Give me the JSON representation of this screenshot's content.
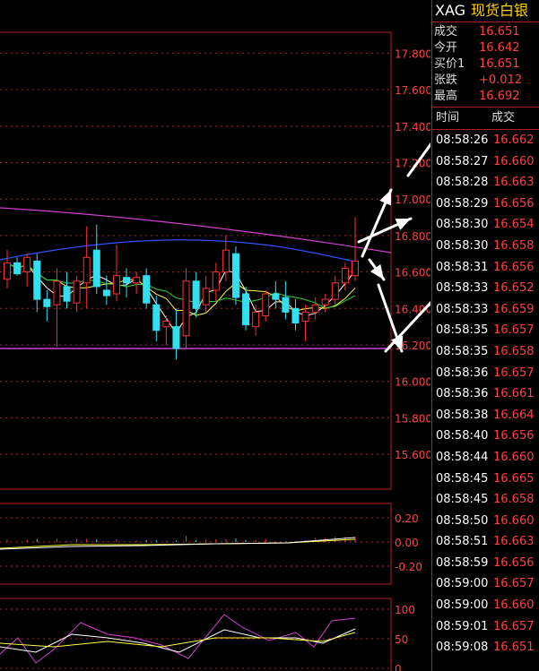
{
  "header": {
    "code": "XAG",
    "name": "现货白银"
  },
  "quote": [
    {
      "label": "成交",
      "value": "16.651"
    },
    {
      "label": "今开",
      "value": "16.642"
    },
    {
      "label": "买价1",
      "value": "16.651"
    },
    {
      "label": "张跌",
      "value": "+0.012"
    },
    {
      "label": "最高",
      "value": "16.692"
    }
  ],
  "ticks_header": {
    "time": "时间",
    "price": "成交"
  },
  "ticks": [
    {
      "time": "08:58:26",
      "price": "16.662"
    },
    {
      "time": "08:58:27",
      "price": "16.660"
    },
    {
      "time": "08:58:28",
      "price": "16.663"
    },
    {
      "time": "08:58:29",
      "price": "16.656"
    },
    {
      "time": "08:58:30",
      "price": "16.654"
    },
    {
      "time": "08:58:30",
      "price": "16.658"
    },
    {
      "time": "08:58:31",
      "price": "16.656"
    },
    {
      "time": "08:58:33",
      "price": "16.652"
    },
    {
      "time": "08:58:33",
      "price": "16.659"
    },
    {
      "time": "08:58:35",
      "price": "16.657"
    },
    {
      "time": "08:58:35",
      "price": "16.658"
    },
    {
      "time": "08:58:36",
      "price": "16.657"
    },
    {
      "time": "08:58:36",
      "price": "16.661"
    },
    {
      "time": "08:58:38",
      "price": "16.664"
    },
    {
      "time": "08:58:40",
      "price": "16.656"
    },
    {
      "time": "08:58:44",
      "price": "16.660"
    },
    {
      "time": "08:58:45",
      "price": "16.665"
    },
    {
      "time": "08:58:45",
      "price": "16.658"
    },
    {
      "time": "08:58:50",
      "price": "16.660"
    },
    {
      "time": "08:58:51",
      "price": "16.663"
    },
    {
      "time": "08:58:59",
      "price": "16.656"
    },
    {
      "time": "08:59:00",
      "price": "16.657"
    },
    {
      "time": "08:59:00",
      "price": "16.660"
    },
    {
      "time": "08:59:01",
      "price": "16.657"
    },
    {
      "time": "08:59:08",
      "price": "16.651"
    }
  ],
  "chart": {
    "price_labels": [
      "17.800",
      "17.600",
      "17.400",
      "17.200",
      "17.000",
      "16.800",
      "16.600",
      "16.400",
      "16.200",
      "16.000",
      "15.800",
      "15.600"
    ],
    "macd_labels": [
      "0.20",
      "0.00",
      "-0.20"
    ],
    "kdj_labels": [
      "100",
      "50",
      "0"
    ],
    "colors": {
      "up": "#ff3030",
      "down": "#30e0f0",
      "ma_purple": "#d040d0",
      "ma_blue": "#3050ff",
      "ma_green": "#30d030",
      "ma_white": "#ffffff",
      "ma_yellow": "#ffff40",
      "grid": "#b02020",
      "arrow": "#ffffff"
    },
    "candles": [
      {
        "o": 16.56,
        "h": 16.72,
        "l": 16.51,
        "c": 16.65
      },
      {
        "o": 16.65,
        "h": 16.68,
        "l": 16.58,
        "c": 16.59
      },
      {
        "o": 16.6,
        "h": 16.7,
        "l": 16.52,
        "c": 16.68
      },
      {
        "o": 16.66,
        "h": 16.7,
        "l": 16.38,
        "c": 16.45
      },
      {
        "o": 16.45,
        "h": 16.5,
        "l": 16.33,
        "c": 16.41
      },
      {
        "o": 16.42,
        "h": 16.62,
        "l": 16.19,
        "c": 16.55
      },
      {
        "o": 16.52,
        "h": 16.6,
        "l": 16.4,
        "c": 16.44
      },
      {
        "o": 16.43,
        "h": 16.58,
        "l": 16.38,
        "c": 16.55
      },
      {
        "o": 16.54,
        "h": 16.85,
        "l": 16.4,
        "c": 16.68
      },
      {
        "o": 16.72,
        "h": 16.86,
        "l": 16.48,
        "c": 16.52
      },
      {
        "o": 16.5,
        "h": 16.58,
        "l": 16.42,
        "c": 16.47
      },
      {
        "o": 16.48,
        "h": 16.75,
        "l": 16.44,
        "c": 16.58
      },
      {
        "o": 16.57,
        "h": 16.62,
        "l": 16.46,
        "c": 16.54
      },
      {
        "o": 16.54,
        "h": 16.6,
        "l": 16.48,
        "c": 16.57
      },
      {
        "o": 16.58,
        "h": 16.62,
        "l": 16.4,
        "c": 16.43
      },
      {
        "o": 16.42,
        "h": 16.47,
        "l": 16.22,
        "c": 16.28
      },
      {
        "o": 16.3,
        "h": 16.36,
        "l": 16.2,
        "c": 16.33
      },
      {
        "o": 16.3,
        "h": 16.4,
        "l": 16.12,
        "c": 16.18
      },
      {
        "o": 16.25,
        "h": 16.62,
        "l": 16.18,
        "c": 16.55
      },
      {
        "o": 16.55,
        "h": 16.6,
        "l": 16.35,
        "c": 16.4
      },
      {
        "o": 16.42,
        "h": 16.58,
        "l": 16.37,
        "c": 16.51
      },
      {
        "o": 16.5,
        "h": 16.65,
        "l": 16.44,
        "c": 16.6
      },
      {
        "o": 16.6,
        "h": 16.8,
        "l": 16.55,
        "c": 16.72
      },
      {
        "o": 16.7,
        "h": 16.74,
        "l": 16.42,
        "c": 16.46
      },
      {
        "o": 16.48,
        "h": 16.52,
        "l": 16.28,
        "c": 16.31
      },
      {
        "o": 16.3,
        "h": 16.42,
        "l": 16.25,
        "c": 16.38
      },
      {
        "o": 16.36,
        "h": 16.5,
        "l": 16.33,
        "c": 16.48
      },
      {
        "o": 16.48,
        "h": 16.55,
        "l": 16.4,
        "c": 16.45
      },
      {
        "o": 16.46,
        "h": 16.55,
        "l": 16.34,
        "c": 16.38
      },
      {
        "o": 16.4,
        "h": 16.45,
        "l": 16.28,
        "c": 16.32
      },
      {
        "o": 16.33,
        "h": 16.42,
        "l": 16.22,
        "c": 16.38
      },
      {
        "o": 16.38,
        "h": 16.46,
        "l": 16.34,
        "c": 16.42
      },
      {
        "o": 16.42,
        "h": 16.48,
        "l": 16.38,
        "c": 16.45
      },
      {
        "o": 16.45,
        "h": 16.58,
        "l": 16.42,
        "c": 16.54
      },
      {
        "o": 16.54,
        "h": 16.65,
        "l": 16.5,
        "c": 16.62
      },
      {
        "o": 16.58,
        "h": 16.9,
        "l": 16.55,
        "c": 16.66
      }
    ]
  }
}
